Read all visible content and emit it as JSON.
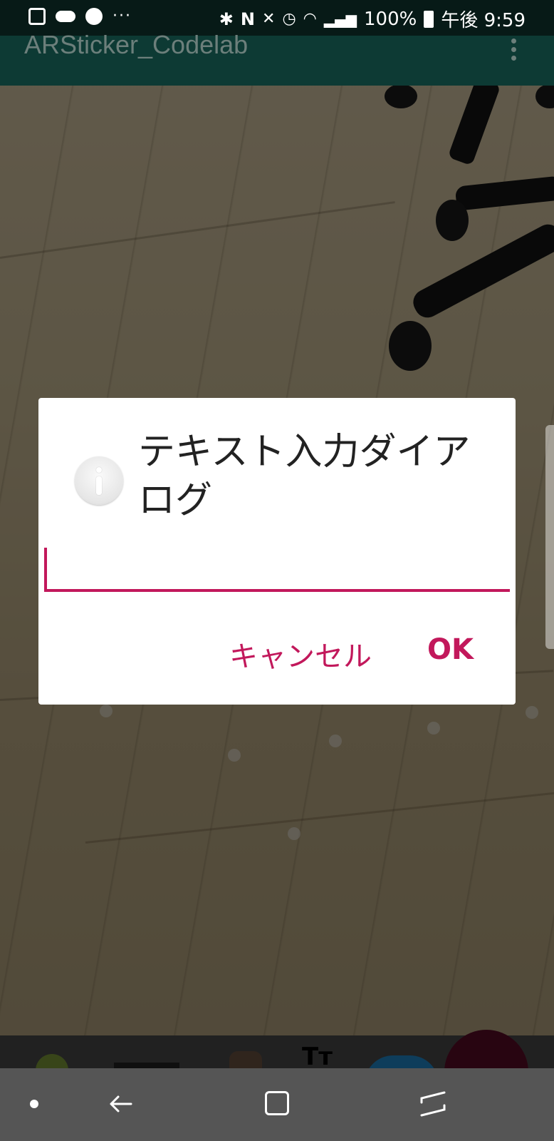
{
  "status_bar": {
    "left_icons": [
      "maps-icon",
      "cloud-icon",
      "soccer-icon",
      "more-notifications-icon"
    ],
    "more": "···",
    "battery": "100%",
    "time": "午後 9:59"
  },
  "app_bar": {
    "title": "ARSticker_Codelab"
  },
  "dialog": {
    "title": "テキスト入力ダイアログ",
    "input_value": "",
    "cancel_label": "キャンセル",
    "ok_label": "OK",
    "accent_color": "#c2185b"
  },
  "sticker_tray": {
    "items": [
      "android-sticker",
      "sign-sticker",
      "cat-sticker",
      "text-sticker",
      "globe-sticker"
    ],
    "text_sticker_label": "Tт"
  },
  "nav_bar": {
    "buttons": [
      "nav-dot",
      "back",
      "home",
      "recents"
    ]
  }
}
